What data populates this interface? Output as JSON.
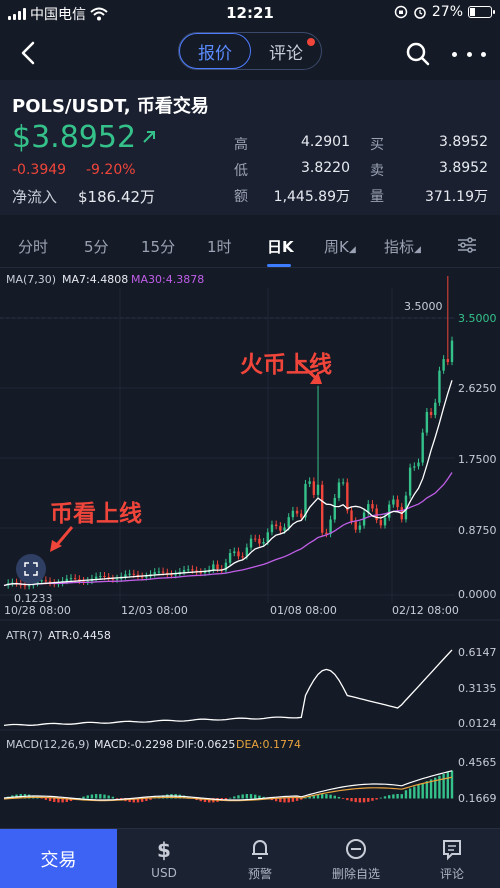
{
  "status": {
    "carrier": "中国电信",
    "time": "12:21",
    "battery": "27%"
  },
  "nav": {
    "tab_quote": "报价",
    "tab_comment": "评论"
  },
  "header": {
    "pair": "POLS/USDT, 币看交易",
    "currency_symbol": "$",
    "price": "3.8952",
    "change_abs": "-0.3949",
    "change_pct": "-9.20%",
    "net_inflow_label": "净流入",
    "net_inflow_value": "$186.42万",
    "stats": {
      "high_label": "高",
      "high": "4.2901",
      "buy_label": "买",
      "buy": "3.8952",
      "low_label": "低",
      "low": "3.8220",
      "sell_label": "卖",
      "sell": "3.8952",
      "amount_label": "额",
      "amount": "1,445.89万",
      "volume_label": "量",
      "volume": "371.19万"
    }
  },
  "tabs": [
    "分时",
    "5分",
    "15分",
    "1时",
    "日K",
    "周K",
    "指标"
  ],
  "active_tab": "日K",
  "ma": {
    "label": "MA(7,30)",
    "ma7": "MA7:4.4808",
    "ma30": "MA30:4.3878"
  },
  "atr": {
    "label": "ATR(7)",
    "value": "ATR:0.4458"
  },
  "macd": {
    "label": "MACD(12,26,9)",
    "macd": "MACD:-0.2298",
    "dif": "DIF:0.0625",
    "dea": "DEA:0.1774"
  },
  "annotations": {
    "huobi": "火币上线",
    "bikan": "币看上线"
  },
  "price_axis": [
    "3.5000",
    "2.6250",
    "1.7500",
    "0.8750",
    "0.0000"
  ],
  "price_marker": "3.5000",
  "current_price_tag": "3.5000",
  "low_marker": "0.1233",
  "date_axis": [
    "10/28 08:00",
    "12/03 08:00",
    "01/08 08:00",
    "02/12 08:00"
  ],
  "atr_axis": [
    "0.6147",
    "0.3135",
    "0.0124"
  ],
  "macd_axis": [
    "0.4565",
    "0.1669"
  ],
  "bottom": {
    "trade": "交易",
    "usd": "USD",
    "alert": "预警",
    "remove": "删除自选",
    "comment": "评论"
  },
  "colors": {
    "up": "#35c28a",
    "down": "#f0453a",
    "accent": "#3d63f5",
    "ma30": "#c05ee8",
    "dea": "#e8a33d"
  },
  "chart_data": {
    "type": "candlestick",
    "x_labels": [
      "10/28 08:00",
      "12/03 08:00",
      "01/08 08:00",
      "02/12 08:00"
    ],
    "y_ticks": [
      0.0,
      0.875,
      1.75,
      2.625,
      3.5
    ],
    "ylim": [
      0,
      3.5
    ],
    "series": [
      {
        "name": "MA7",
        "last": 4.4808
      },
      {
        "name": "MA30",
        "last": 4.3878
      }
    ]
  }
}
